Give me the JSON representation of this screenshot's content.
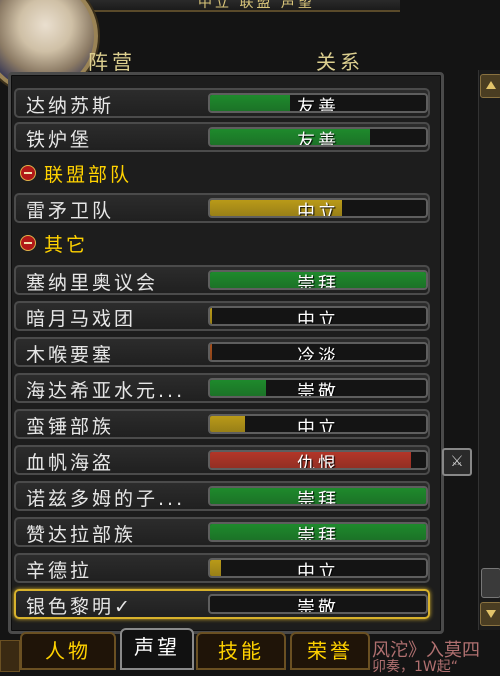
{
  "title": "中立 联盟 声望",
  "columns": {
    "faction": "阵营",
    "standing": "关系"
  },
  "rows": [
    {
      "kind": "faction",
      "name": "达纳苏斯",
      "standing": "友善",
      "fill": 0.37,
      "color": "#1e8a2c"
    },
    {
      "kind": "faction",
      "name": "铁炉堡",
      "standing": "友善",
      "fill": 0.74,
      "color": "#1e8a2c"
    },
    {
      "kind": "header",
      "name": "联盟部队"
    },
    {
      "kind": "faction",
      "name": "雷矛卫队",
      "standing": "中立",
      "fill": 0.61,
      "color": "#b99a18"
    },
    {
      "kind": "header",
      "name": "其它"
    },
    {
      "kind": "faction",
      "name": "塞纳里奥议会",
      "standing": "崇拜",
      "fill": 1.0,
      "color": "#1e8a2c"
    },
    {
      "kind": "faction",
      "name": "暗月马戏团",
      "standing": "中立",
      "fill": 0.01,
      "color": "#b99a18"
    },
    {
      "kind": "faction",
      "name": "木喉要塞",
      "standing": "冷淡",
      "fill": 0.01,
      "color": "#a8501c"
    },
    {
      "kind": "faction",
      "name": "海达希亚水元...",
      "standing": "崇敬",
      "fill": 0.26,
      "color": "#1e8a2c"
    },
    {
      "kind": "faction",
      "name": "蛮锤部族",
      "standing": "中立",
      "fill": 0.16,
      "color": "#b99a18"
    },
    {
      "kind": "faction",
      "name": "血帆海盗",
      "standing": "仇恨",
      "fill": 0.93,
      "color": "#b33628"
    },
    {
      "kind": "faction",
      "name": "诺兹多姆的子...",
      "standing": "崇拜",
      "fill": 1.0,
      "color": "#1e8a2c"
    },
    {
      "kind": "faction",
      "name": "赞达拉部族",
      "standing": "崇拜",
      "fill": 1.0,
      "color": "#1e8a2c"
    },
    {
      "kind": "faction",
      "name": "辛德拉",
      "standing": "中立",
      "fill": 0.05,
      "color": "#b99a18"
    },
    {
      "kind": "faction",
      "name": "银色黎明✓",
      "standing": "崇敬",
      "fill": 0.0,
      "color": "#1e8a2c",
      "selected": true
    }
  ],
  "tabs": [
    {
      "label": "人物",
      "active": false
    },
    {
      "label": "声望",
      "active": true
    },
    {
      "label": "技能",
      "active": false
    },
    {
      "label": "荣誉",
      "active": false
    }
  ],
  "background_text": {
    "line1": "风沱》入莫四",
    "line2": "卯奏，1W起“"
  },
  "side_button": {
    "icon": "crossed-swords-icon"
  },
  "colors": {
    "gold": "#ffd200",
    "green": "#1e8a2c",
    "yellow": "#b99a18",
    "red": "#b33628",
    "orange": "#a8501c"
  }
}
